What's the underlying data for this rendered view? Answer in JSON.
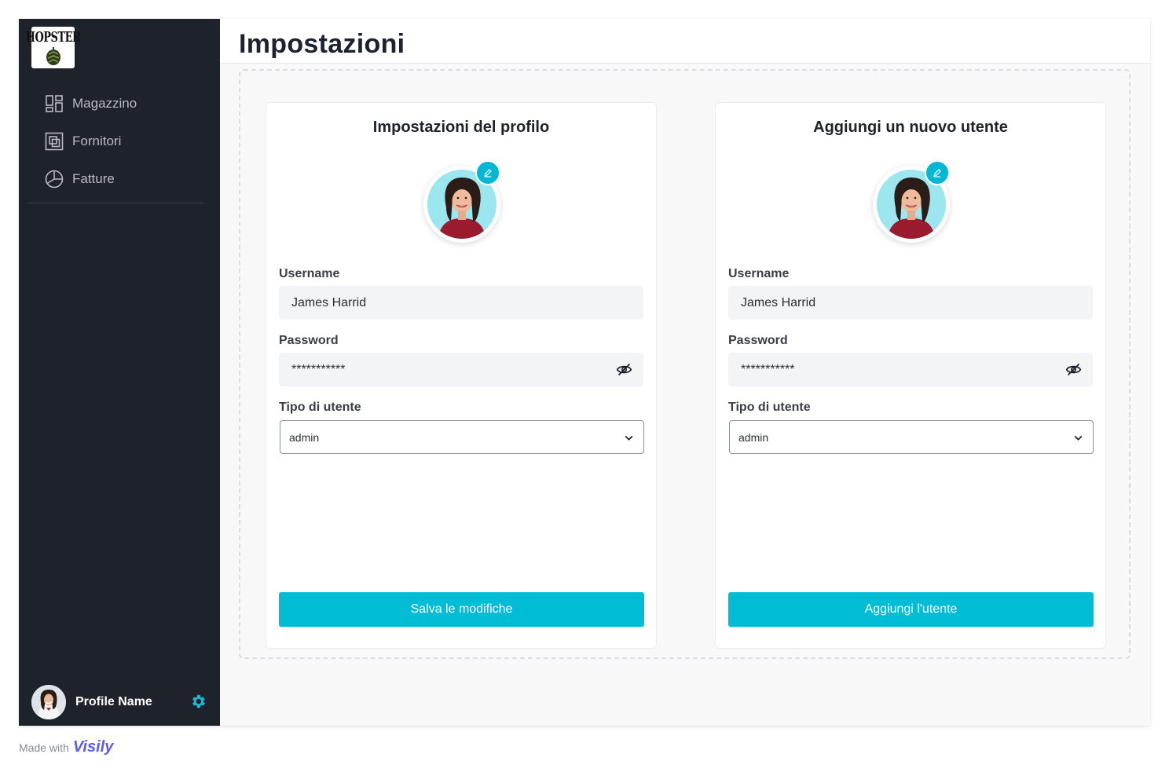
{
  "sidebar": {
    "logo_text": "HOPSTER",
    "items": [
      {
        "label": "Magazzino",
        "icon": "dashboard-icon"
      },
      {
        "label": "Fornitori",
        "icon": "layers-icon"
      },
      {
        "label": "Fatture",
        "icon": "pie-chart-icon"
      }
    ],
    "profile_name": "Profile Name"
  },
  "header": {
    "title": "Impostazioni"
  },
  "profile_card": {
    "title": "Impostazioni del profilo",
    "username_label": "Username",
    "username_value": "James Harrid",
    "password_label": "Password",
    "password_value": "***********",
    "user_type_label": "Tipo di utente",
    "user_type_value": "admin",
    "button_label": "Salva le modifiche"
  },
  "new_user_card": {
    "title": "Aggiungi un nuovo utente",
    "username_label": "Username",
    "username_value": "James Harrid",
    "password_label": "Password",
    "password_value": "***********",
    "user_type_label": "Tipo di utente",
    "user_type_value": "admin",
    "button_label": "Aggiungi l'utente"
  },
  "footer": {
    "made_with": "Made with",
    "brand": "Visily"
  },
  "colors": {
    "sidebar_bg": "#1e222b",
    "accent": "#00bcd4",
    "page_bg": "#f8f8f9"
  }
}
